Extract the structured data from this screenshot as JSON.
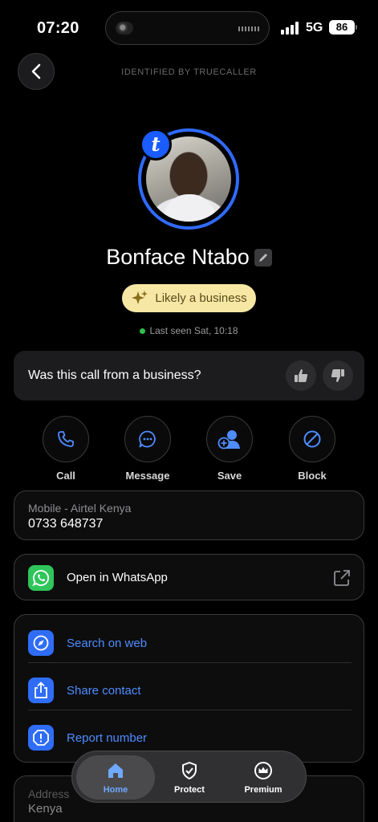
{
  "status_bar": {
    "time": "07:20",
    "network": "5G",
    "battery": "86"
  },
  "header": {
    "label": "IDENTIFIED BY TRUECALLER"
  },
  "profile": {
    "badge_letter": "t",
    "name": "Bonface Ntabo",
    "business_pill": "Likely a business",
    "last_seen": "Last seen Sat, 10:18"
  },
  "feedback": {
    "question": "Was this call from a business?"
  },
  "actions": [
    {
      "label": "Call",
      "icon": "phone-icon"
    },
    {
      "label": "Message",
      "icon": "message-icon"
    },
    {
      "label": "Save",
      "icon": "add-contact-icon"
    },
    {
      "label": "Block",
      "icon": "block-icon"
    }
  ],
  "phone": {
    "label": "Mobile - Airtel Kenya",
    "number": "0733 648737"
  },
  "whatsapp": {
    "label": "Open in WhatsApp"
  },
  "links": [
    {
      "label": "Search on web",
      "icon": "compass-icon"
    },
    {
      "label": "Share contact",
      "icon": "share-icon"
    },
    {
      "label": "Report number",
      "icon": "report-icon"
    }
  ],
  "address": {
    "label": "Address",
    "value": "Kenya"
  },
  "bottom_nav": [
    {
      "label": "Home",
      "icon": "home-icon",
      "active": true
    },
    {
      "label": "Protect",
      "icon": "shield-icon",
      "active": false
    },
    {
      "label": "Premium",
      "icon": "crown-icon",
      "active": false
    }
  ],
  "colors": {
    "accent": "#2f6bff",
    "link": "#4f8cff",
    "pill": "#f6e7a4",
    "whatsapp": "#2fc55a",
    "background": "#000000"
  }
}
